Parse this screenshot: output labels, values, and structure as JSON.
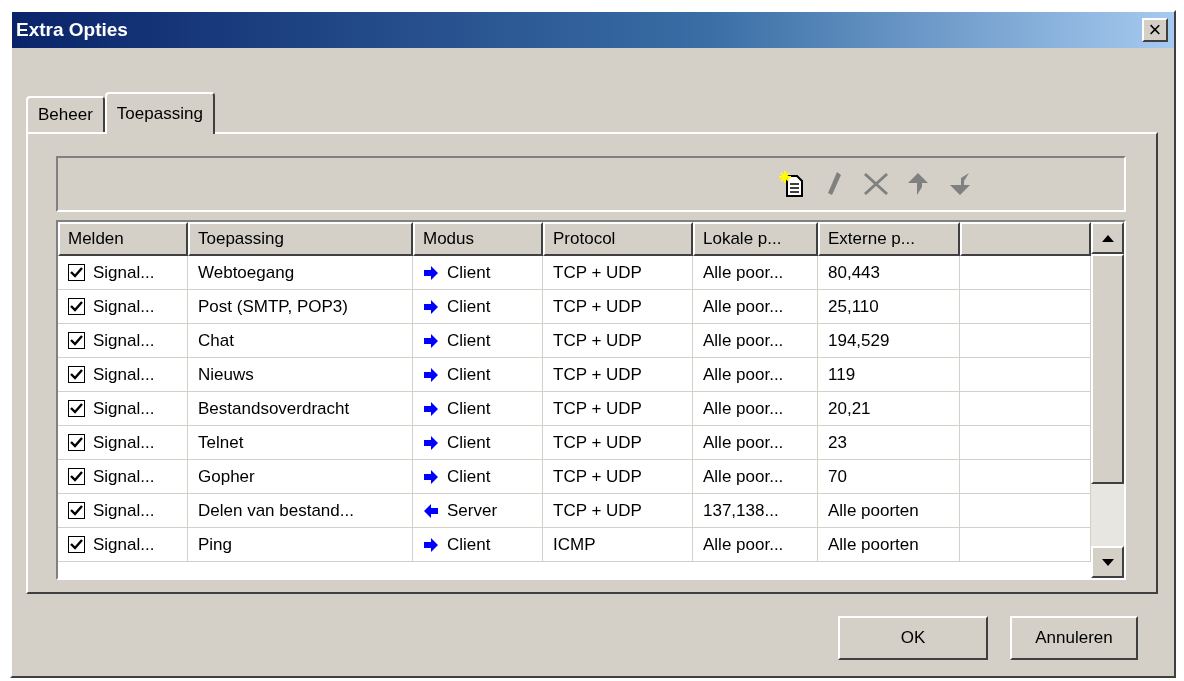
{
  "window": {
    "title": "Extra Opties",
    "close": "×"
  },
  "tabs": [
    {
      "label": "Beheer",
      "selected": false
    },
    {
      "label": "Toepassing",
      "selected": true
    }
  ],
  "toolbar": [
    {
      "kind": "new",
      "disabled": false
    },
    {
      "kind": "edit",
      "disabled": true
    },
    {
      "kind": "delete",
      "disabled": true
    },
    {
      "kind": "up",
      "disabled": true
    },
    {
      "kind": "down",
      "disabled": true
    }
  ],
  "table": {
    "columns": [
      "Melden",
      "Toepassing",
      "Modus",
      "Protocol",
      "Lokale p...",
      "Externe p..."
    ],
    "rows": [
      {
        "checked": true,
        "melden": "Signal...",
        "toepassing": "Webtoegang",
        "kind": "out",
        "modus": "Client",
        "protocol": "TCP + UDP",
        "lokale": "Alle poor...",
        "externe": "80,443"
      },
      {
        "checked": true,
        "melden": "Signal...",
        "toepassing": "Post (SMTP, POP3)",
        "kind": "out",
        "modus": "Client",
        "protocol": "TCP + UDP",
        "lokale": "Alle poor...",
        "externe": "25,110"
      },
      {
        "checked": true,
        "melden": "Signal...",
        "toepassing": "Chat",
        "kind": "out",
        "modus": "Client",
        "protocol": "TCP + UDP",
        "lokale": "Alle poor...",
        "externe": "194,529"
      },
      {
        "checked": true,
        "melden": "Signal...",
        "toepassing": "Nieuws",
        "kind": "out",
        "modus": "Client",
        "protocol": "TCP + UDP",
        "lokale": "Alle poor...",
        "externe": "119"
      },
      {
        "checked": true,
        "melden": "Signal...",
        "toepassing": "Bestandsoverdracht",
        "kind": "out",
        "modus": "Client",
        "protocol": "TCP + UDP",
        "lokale": "Alle poor...",
        "externe": "20,21"
      },
      {
        "checked": true,
        "melden": "Signal...",
        "toepassing": "Telnet",
        "kind": "out",
        "modus": "Client",
        "protocol": "TCP + UDP",
        "lokale": "Alle poor...",
        "externe": "23"
      },
      {
        "checked": true,
        "melden": "Signal...",
        "toepassing": "Gopher",
        "kind": "out",
        "modus": "Client",
        "protocol": "TCP + UDP",
        "lokale": "Alle poor...",
        "externe": "70"
      },
      {
        "checked": true,
        "melden": "Signal...",
        "toepassing": "Delen van bestand...",
        "kind": "in",
        "modus": "Server",
        "protocol": "TCP + UDP",
        "lokale": "137,138...",
        "externe": "Alle poorten"
      },
      {
        "checked": true,
        "melden": "Signal...",
        "toepassing": "Ping",
        "kind": "out",
        "modus": "Client",
        "protocol": "ICMP",
        "lokale": "Alle poor...",
        "externe": "Alle poorten"
      }
    ]
  },
  "buttons": [
    {
      "label": "OK"
    },
    {
      "label": "Annuleren"
    }
  ]
}
